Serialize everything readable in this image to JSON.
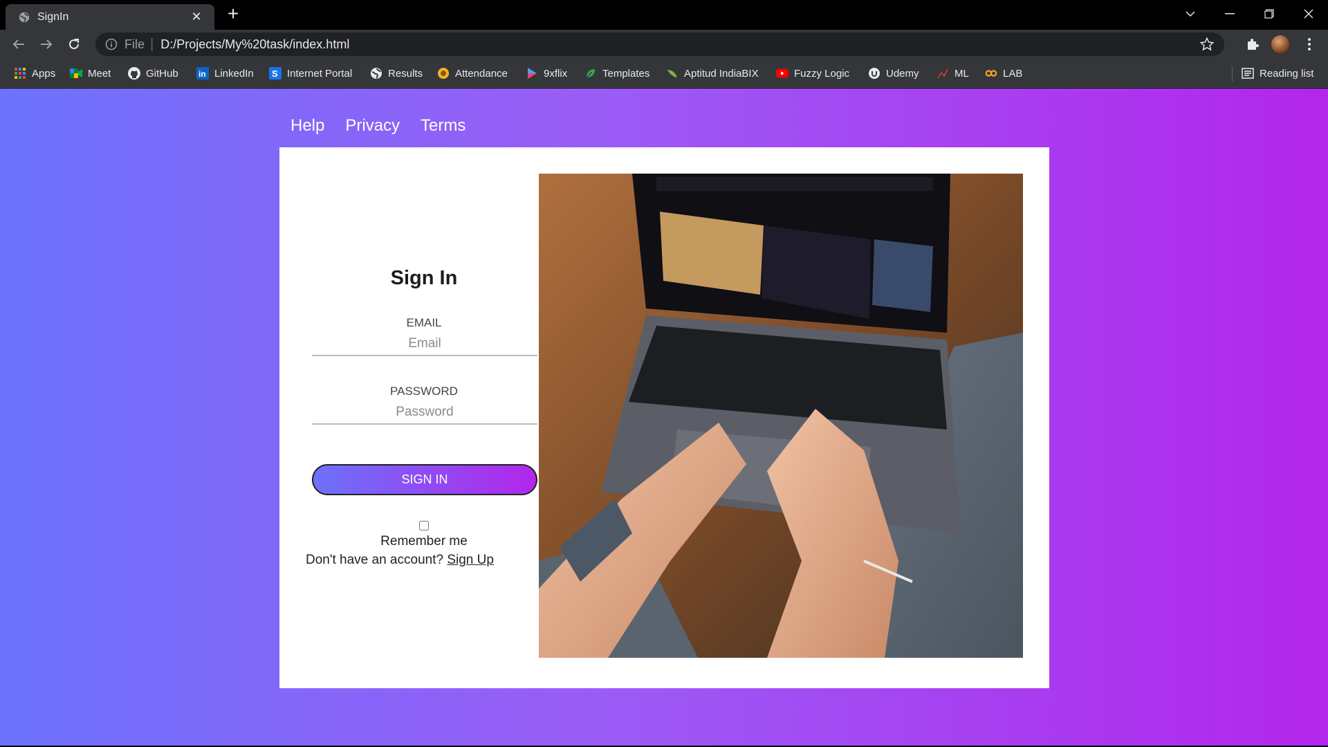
{
  "browser": {
    "tab_title": "SignIn",
    "url_scheme": "File",
    "url": "D:/Projects/My%20task/index.html",
    "bookmarks": [
      {
        "label": "Apps",
        "icon": "apps-grid-icon"
      },
      {
        "label": "Meet",
        "icon": "meet-icon"
      },
      {
        "label": "GitHub",
        "icon": "github-icon"
      },
      {
        "label": "LinkedIn",
        "icon": "linkedin-icon"
      },
      {
        "label": "Internet Portal",
        "icon": "portal-icon"
      },
      {
        "label": "Results",
        "icon": "globe-icon"
      },
      {
        "label": "Attendance",
        "icon": "attendance-icon"
      },
      {
        "label": "9xflix",
        "icon": "play-icon"
      },
      {
        "label": "Templates",
        "icon": "leaf-icon"
      },
      {
        "label": "Aptitud IndiaBIX",
        "icon": "leaf-icon"
      },
      {
        "label": "Fuzzy Logic",
        "icon": "youtube-icon"
      },
      {
        "label": "Udemy",
        "icon": "udemy-icon"
      },
      {
        "label": "ML",
        "icon": "chart-icon"
      },
      {
        "label": "LAB",
        "icon": "infinity-icon"
      }
    ],
    "reading_list": "Reading list"
  },
  "nav": {
    "help": "Help",
    "privacy": "Privacy",
    "terms": "Terms"
  },
  "signin": {
    "title": "Sign In",
    "email_label": "EMAIL",
    "email_placeholder": "Email",
    "password_label": "PASSWORD",
    "password_placeholder": "Password",
    "button": "SIGN IN",
    "remember": "Remember me",
    "no_account": "Don't have an account?",
    "signup_link": "Sign Up"
  },
  "colors": {
    "gradient_start": "#6c72fb",
    "gradient_end": "#b326eb"
  }
}
